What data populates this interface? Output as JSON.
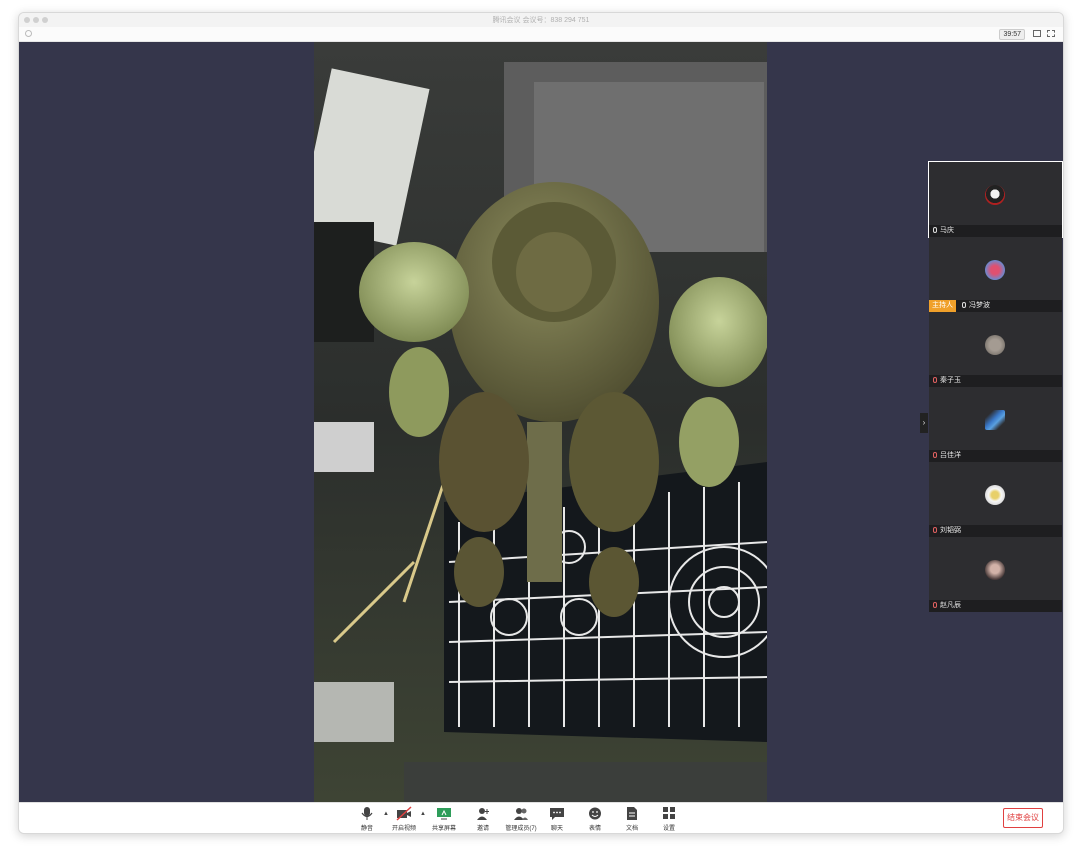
{
  "window": {
    "title": "腾讯会议 会议号：838 294 751"
  },
  "topbar": {
    "timer": "39:57"
  },
  "participants": [
    {
      "name": "马庆",
      "host": false,
      "active": true
    },
    {
      "name": "冯梦波",
      "host": true,
      "host_label": "主持人",
      "active": false
    },
    {
      "name": "秦子玉",
      "host": false,
      "active": false
    },
    {
      "name": "吕佳洋",
      "host": false,
      "active": false
    },
    {
      "name": "刘韬弼",
      "host": false,
      "active": false
    },
    {
      "name": "赵凡辰",
      "host": false,
      "active": false
    }
  ],
  "video": {
    "description_icon": "robot-figure-video"
  },
  "toolbar": {
    "mute": "静音",
    "video": "开启视频",
    "share": "共享屏幕",
    "invite": "邀请",
    "members": "管理成员(7)",
    "chat": "聊天",
    "reaction": "表情",
    "docs": "文档",
    "settings": "设置",
    "end": "结束会议"
  },
  "colors": {
    "stage": "#35364b",
    "host_badge": "#f0a02a",
    "end_button": "#e04040"
  }
}
